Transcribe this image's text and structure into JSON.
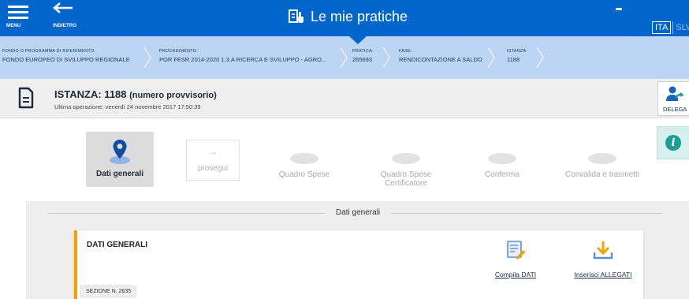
{
  "header": {
    "menu_label": "MENU",
    "back_label": "INDIETRO",
    "title": "Le mie pratiche",
    "lang_active": "ITA",
    "lang_other": "SLV",
    "colors": {
      "primary": "#0066cc",
      "breadcrumb_bg": "#bcd5f4"
    }
  },
  "breadcrumb": [
    {
      "key": "FONDO O PROGRAMMA DI RIFERIMENTO:",
      "value": "FONDO EUROPEO DI SVILUPPO REGIONALE"
    },
    {
      "key": "PROCEDIMENTO:",
      "value": "POR FESR 2014-2020 1.3.A RICERCA E SVILUPPO - AGRO..."
    },
    {
      "key": "PRATICA:",
      "value": "265693"
    },
    {
      "key": "FASE:",
      "value": "RENDICONTAZIONE A SALDO"
    },
    {
      "key": "ISTANZA:",
      "value": "1188"
    }
  ],
  "istanza": {
    "title": "ISTANZA: 1188",
    "provisional": "(numero provvisorio)",
    "last_op": "Ultima operazione: venerdì 24 novembre 2017 17:50:39",
    "delega_label": "DELEGA"
  },
  "stepper": {
    "active": "Dati generali",
    "next_label": "prosegui",
    "next_arrow": "→",
    "steps": [
      {
        "label": "Quadro Spese"
      },
      {
        "label": "Quadro Spese Certificatore"
      },
      {
        "label": "Conferma"
      },
      {
        "label": "Convalida e trasmetti"
      }
    ],
    "info_icon": "i"
  },
  "section": {
    "title": "Dati generali",
    "card_title": "DATI GENERALI",
    "badge": "SEZIONE N. 2635",
    "actions": [
      {
        "label": "Compila DATI",
        "icon": "edit-form-icon"
      },
      {
        "label": "Inserisci ALLEGATI",
        "icon": "download-icon"
      }
    ],
    "accent": "#f5a300"
  }
}
